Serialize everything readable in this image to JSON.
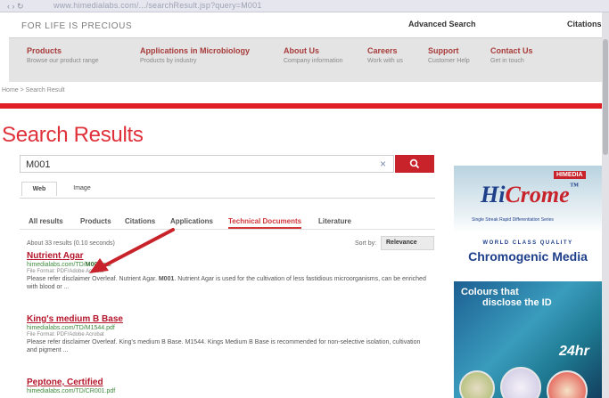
{
  "browser": {
    "nav_icons": "‹ ›  ↻",
    "url": "www.himedialabs.com/.../searchResult.jsp?query=M001"
  },
  "header": {
    "slogan": "FOR LIFE IS PRECIOUS",
    "advanced_search": "Advanced Search",
    "citations": "Citations"
  },
  "nav": [
    {
      "title": "Products",
      "sub": "Browse our product range"
    },
    {
      "title": "Applications in Microbiology",
      "sub": "Products by industry"
    },
    {
      "title": "About Us",
      "sub": "Company information"
    },
    {
      "title": "Careers",
      "sub": "Work with us"
    },
    {
      "title": "Support",
      "sub": "Customer Help"
    },
    {
      "title": "Contact Us",
      "sub": "Get in touch"
    }
  ],
  "breadcrumb": "Home > Search Result",
  "page_title": "Search Results",
  "search": {
    "value": "M001",
    "clear_glyph": "×",
    "button_icon": "search-icon"
  },
  "type_tabs": [
    "Web",
    "Image"
  ],
  "filter_tabs": [
    "All results",
    "Products",
    "Citations",
    "Applications",
    "Technical Documents",
    "Literature"
  ],
  "active_filter": "Technical Documents",
  "results_meta": {
    "count": "About 33 results (0.10 seconds)",
    "sort_label": "Sort by:",
    "sort_value": "Relevance"
  },
  "results": [
    {
      "title": "Nutrient Agar",
      "url_prefix": "himedialabs.com/TD/",
      "url_bold": "M001",
      "url_suffix": ".pdf",
      "format": "File Format: PDF/Adobe Acrobat",
      "snippet_pre": "Please refer disclaimer Overleaf. Nutrient Agar. ",
      "snippet_bold": "M001",
      "snippet_post": ". Nutrient Agar is used for the cultivation of less fastidious microorganisms, can be enriched with blood or ..."
    },
    {
      "title": "King's medium B Base",
      "url_prefix": "himedialabs.com/TD/M1544.pdf",
      "url_bold": "",
      "url_suffix": "",
      "format": "File Format: PDF/Adobe Acrobat",
      "snippet_pre": "Please refer disclaimer Overleaf. King's medium B Base. M1544. Kings Medium B Base is recommended for non-selective isolation, cultivation and pigment ...",
      "snippet_bold": "",
      "snippet_post": ""
    },
    {
      "title": "Peptone, Certified",
      "url_prefix": "himedialabs.com/TD/CR001.pdf",
      "url_bold": "",
      "url_suffix": "",
      "format": "",
      "snippet_pre": "",
      "snippet_bold": "",
      "snippet_post": ""
    }
  ],
  "ad": {
    "badge": "HIMEDIA",
    "logo_h": "Hi",
    "logo_rest": "Crome",
    "logo_tm": "™",
    "tagline": "Single Streak Rapid Differentiation Series",
    "world_class": "WORLD CLASS QUALITY",
    "chromogenic": "Chromogenic Media",
    "colours_line1": "Colours that",
    "colours_line2": "disclose the ID",
    "hours": "24hr",
    "colors": {
      "red": "#c8232b",
      "blue": "#1e3f8a"
    }
  },
  "colors": {
    "accent_red": "#e01f24",
    "link_green": "#3f8b3f",
    "title_red": "#e0313a"
  }
}
